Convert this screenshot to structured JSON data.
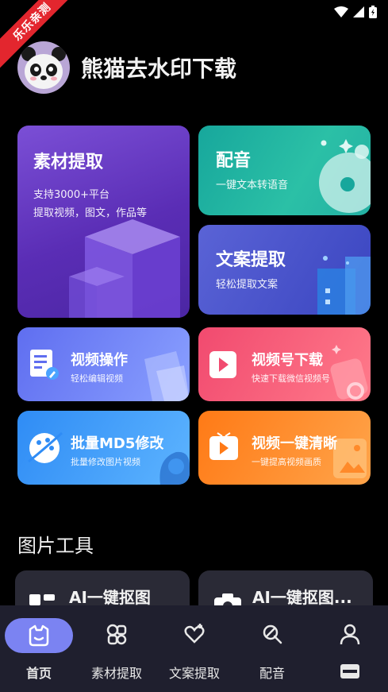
{
  "ribbon": {
    "label": "乐乐亲测"
  },
  "header": {
    "title": "熊猫去水印下载"
  },
  "cards": {
    "material": {
      "title": "素材提取",
      "line1": "支持3000+平台",
      "line2": "提取视频，图文，作品等"
    },
    "voice": {
      "title": "配音",
      "sub": "一键文本转语音"
    },
    "copy": {
      "title": "文案提取",
      "sub": "轻松提取文案"
    },
    "video_op": {
      "title": "视频操作",
      "sub": "轻松编辑视频"
    },
    "channel": {
      "title": "视频号下载",
      "sub": "快速下载微信视频号"
    },
    "md5": {
      "title": "批量MD5修改",
      "sub": "批量修改图片视频"
    },
    "hd": {
      "title": "视频一键清晰",
      "sub": "一键提高视频画质"
    }
  },
  "section": {
    "title": "图片工具"
  },
  "tools": [
    {
      "label": "AI一键抠图"
    },
    {
      "label": "AI一键抠图..."
    }
  ],
  "tabbar": {
    "items": [
      {
        "label": "首页",
        "icon": "home-icon",
        "active": true
      },
      {
        "label": "素材提取",
        "icon": "material-icon"
      },
      {
        "label": "文案提取",
        "icon": "copy-icon"
      },
      {
        "label": "配音",
        "icon": "voice-icon"
      },
      {
        "label": "",
        "icon": "profile-icon"
      }
    ]
  },
  "colors": {
    "active_tab": "#7b83f2",
    "tabbar_bg": "#1f1f2e",
    "ribbon": "#e3262e"
  }
}
